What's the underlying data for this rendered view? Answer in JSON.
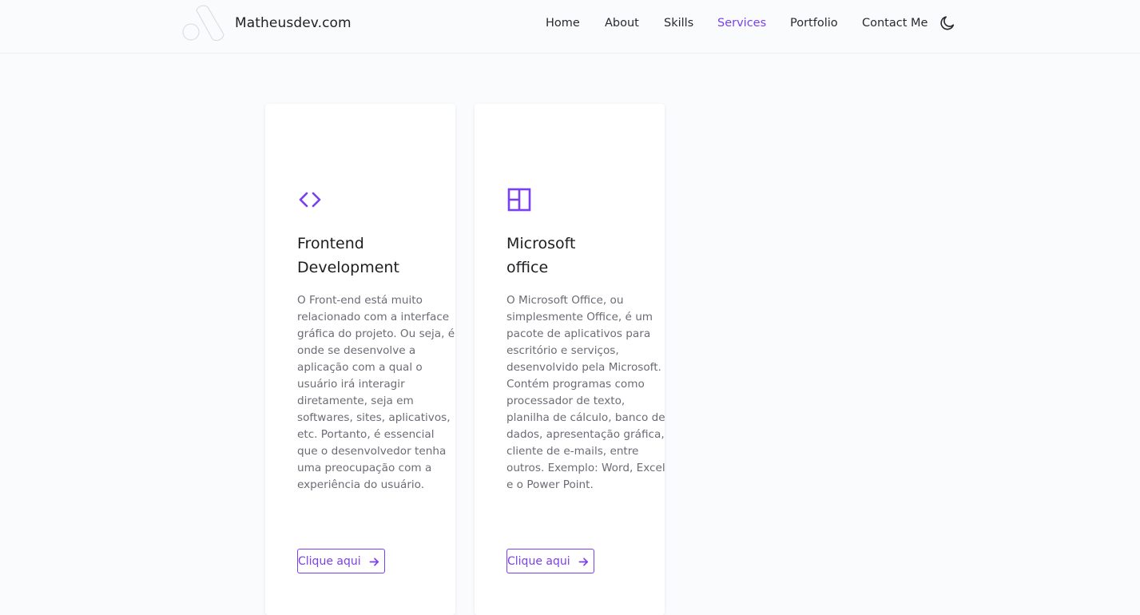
{
  "header": {
    "brand": "Matheusdev.com",
    "nav": [
      {
        "label": "Home",
        "active": false
      },
      {
        "label": "About",
        "active": false
      },
      {
        "label": "Skills",
        "active": false
      },
      {
        "label": "Services",
        "active": true
      },
      {
        "label": "Portfolio",
        "active": false
      },
      {
        "label": "Contact Me",
        "active": false
      }
    ],
    "theme_icon": "moon-icon"
  },
  "colors": {
    "accent": "#7a3ff0",
    "text": "#1f1f24",
    "muted": "#6b6b75",
    "background": "#fafbfd"
  },
  "services": [
    {
      "icon": "code-icon",
      "title_line1": "Frontend",
      "title_line2": "Development",
      "description": "O Front-end está muito relacionado com a interface gráfica do projeto. Ou seja, é onde se desenvolve a aplicação com a qual o usuário irá interagir diretamente, seja em softwares, sites, aplicativos, etc. Portanto, é essencial que o desenvolvedor tenha uma preocupação com a experiência do usuário.",
      "button": "Clique aqui"
    },
    {
      "icon": "layout-icon",
      "title_line1": "Microsoft",
      "title_line2": "office",
      "description": "O Microsoft Office, ou simplesmente Office, é um pacote de aplicativos para escritório e serviços, desenvolvido pela Microsoft. Contém programas como processador de texto, planilha de cálculo, banco de dados, apresentação gráfica, cliente de e-mails, entre outros. Exemplo: Word, Excel e o Power Point.",
      "button": "Clique aqui"
    }
  ]
}
